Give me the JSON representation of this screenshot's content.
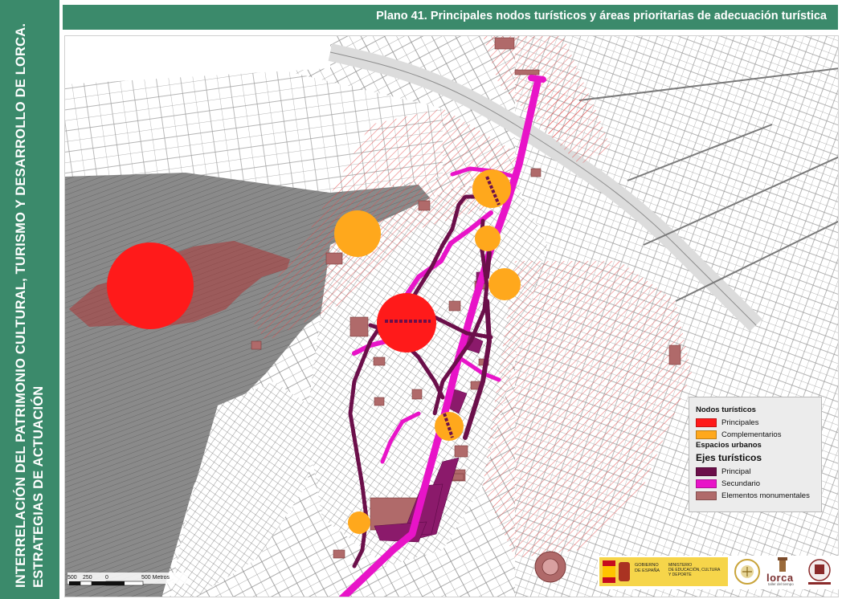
{
  "sidebar": {
    "line1": "INTERRELACIÓN DEL PATRIMONIO CULTURAL, TURISMO Y DESARROLLO DE LORCA.",
    "line2": "ESTRATEGIAS DE ACTUACIÓN"
  },
  "header": {
    "title": "Plano 41. Principales nodos turísticos y áreas prioritarias de adecuación turística"
  },
  "legend": {
    "nodos_title": "Nodos turísticos",
    "principales": "Principales",
    "complementarios": "Complementarios",
    "espacios_title": "Espacios urbanos",
    "ejes_title": "Ejes turísticos",
    "principal": "Principal",
    "secundario": "Secundario",
    "elementos": "Elementos monumentales"
  },
  "scale": {
    "labels": [
      "500",
      "250",
      "0",
      "500 Metros"
    ]
  },
  "logos": {
    "gob_line1": "GOBIERNO",
    "gob_line2": "DE ESPAÑA",
    "min_line1": "MINISTERIO",
    "min_line2": "DE EDUCACIÓN, CULTURA",
    "min_line3": "Y DEPORTE",
    "lorca": "lorca",
    "lorca_sub": "taller del tiempo"
  },
  "colors": {
    "sidebar": "#3b8a6b",
    "principales": "#ff1a1a",
    "complementarios": "#ffa81c",
    "eje_principal": "#6b0f4a",
    "eje_secundario": "#e814c8",
    "elementos": "#b06a6a"
  }
}
